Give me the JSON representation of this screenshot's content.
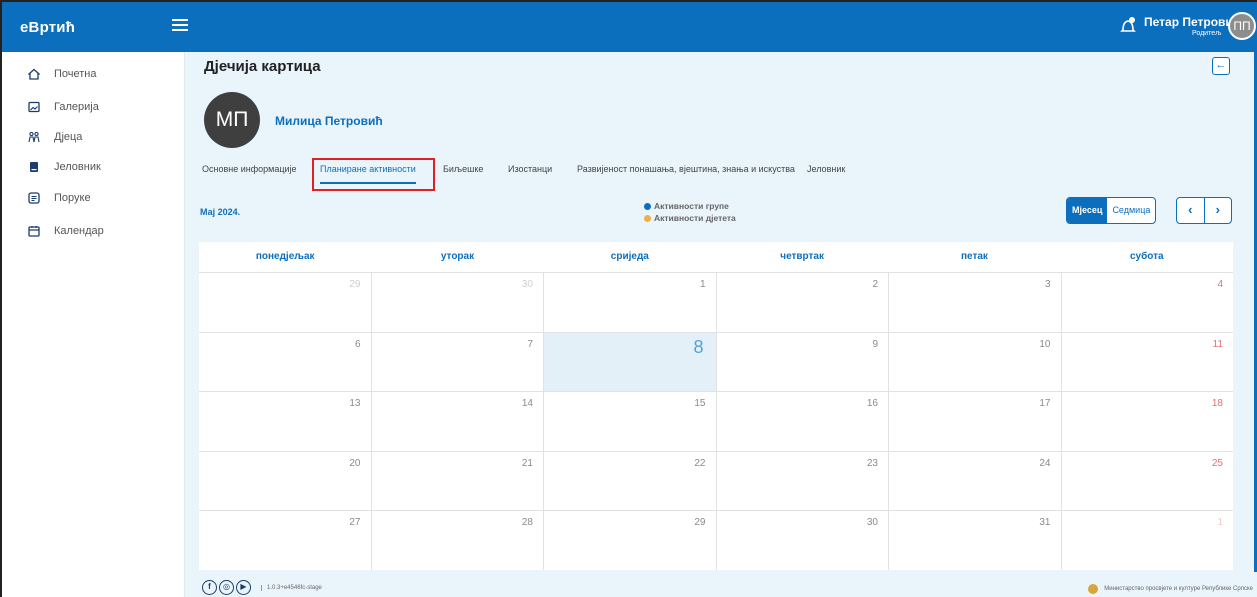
{
  "app": {
    "logo": "eВртић",
    "menu_icon": "hamburger-icon"
  },
  "user": {
    "name": "Петар Петровић",
    "role": "Родитељ",
    "initials": "ПП",
    "bell_icon": "bell-icon"
  },
  "sidebar": {
    "items": [
      {
        "label": "Почетна",
        "icon": "home-icon"
      },
      {
        "label": "Галерија",
        "icon": "image-icon"
      },
      {
        "label": "Дјеца",
        "icon": "children-icon"
      },
      {
        "label": "Јеловник",
        "icon": "menu-book-icon"
      },
      {
        "label": "Поруке",
        "icon": "message-icon"
      },
      {
        "label": "Календар",
        "icon": "calendar-icon"
      }
    ]
  },
  "page": {
    "title": "Дјечија картица",
    "back_icon": "←"
  },
  "child": {
    "initials": "МП",
    "name": "Милица Петровић"
  },
  "tabs": [
    {
      "label": "Основне информације",
      "active": false
    },
    {
      "label": "Планиране активности",
      "active": true
    },
    {
      "label": "Биљешке",
      "active": false
    },
    {
      "label": "Изостанци",
      "active": false
    },
    {
      "label": "Развијеност понашања, вјештина, знања и искуства",
      "active": false
    },
    {
      "label": "Јеловник",
      "active": false
    }
  ],
  "calendar": {
    "month_label": "Мај 2024.",
    "legend": [
      {
        "label": "Активности групе",
        "color": "#0c6fbe"
      },
      {
        "label": "Активности дјетета",
        "color": "#f0b040"
      }
    ],
    "view_month": "Мјесец",
    "view_week": "Седмица",
    "prev": "‹",
    "next": "›",
    "weekdays": [
      "понедјељак",
      "уторак",
      "сриједа",
      "четвртак",
      "петак",
      "субота"
    ],
    "weeks": [
      [
        {
          "d": "29",
          "other": true
        },
        {
          "d": "30",
          "other": true
        },
        {
          "d": "1"
        },
        {
          "d": "2"
        },
        {
          "d": "3"
        },
        {
          "d": "4",
          "sat": true
        }
      ],
      [
        {
          "d": "6"
        },
        {
          "d": "7"
        },
        {
          "d": "8",
          "today": true
        },
        {
          "d": "9"
        },
        {
          "d": "10"
        },
        {
          "d": "11",
          "sat": true
        }
      ],
      [
        {
          "d": "13"
        },
        {
          "d": "14"
        },
        {
          "d": "15"
        },
        {
          "d": "16"
        },
        {
          "d": "17"
        },
        {
          "d": "18",
          "sat": true
        }
      ],
      [
        {
          "d": "20"
        },
        {
          "d": "21"
        },
        {
          "d": "22"
        },
        {
          "d": "23"
        },
        {
          "d": "24"
        },
        {
          "d": "25",
          "sat": true
        }
      ],
      [
        {
          "d": "27"
        },
        {
          "d": "28"
        },
        {
          "d": "29"
        },
        {
          "d": "30"
        },
        {
          "d": "31"
        },
        {
          "d": "1",
          "sat": true,
          "other": true
        }
      ]
    ]
  },
  "footer": {
    "social": [
      "f",
      "◎",
      "▶"
    ],
    "version": "1.0.3+e4546fc-stage",
    "ministry": "Министарство просвјете и културе Републике Српске"
  },
  "colors": {
    "primary": "#0c6fbe",
    "highlight": "#e31f26",
    "today_bg": "#e3f0f7"
  }
}
